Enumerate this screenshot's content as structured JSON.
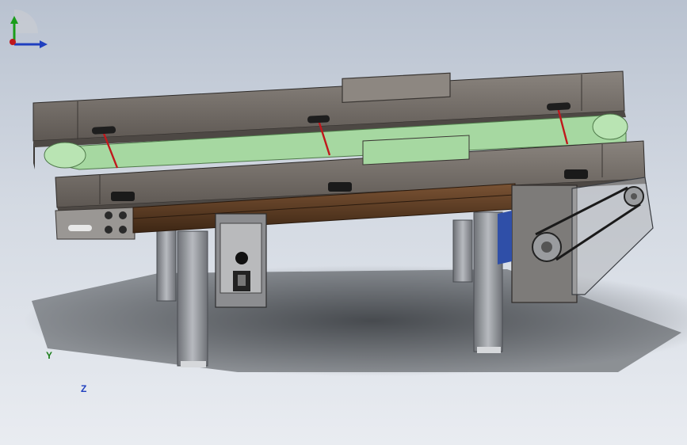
{
  "viewport": {
    "background_top": "#b9c2d0",
    "background_bottom": "#e9ecf1"
  },
  "model": {
    "parts": [
      "rear-side-rail",
      "front-side-rail",
      "conveyor-belt",
      "belt-tension-rods",
      "lower-frame-beam",
      "support-legs",
      "control-box",
      "drive-motor",
      "belt-drive-guard"
    ],
    "colors": {
      "rail": "#6b6560",
      "rail_dark": "#4d4844",
      "belt": "#9fd49a",
      "beam": "#5a3a22",
      "leg": "#8c8f94",
      "tension_rod": "#c0181c"
    }
  },
  "triad": {
    "y_label": "Y",
    "z_label": "Z",
    "x_color": "#c0181c",
    "y_color": "#1a9d1a",
    "z_color": "#1f3fbf",
    "icon": "coordinate-triad-icon"
  }
}
